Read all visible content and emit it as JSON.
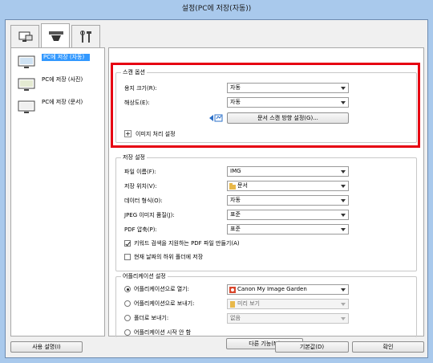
{
  "window": {
    "title": "설정(PC에 저장(자동))"
  },
  "tabs": [
    {
      "icon": "scan-to-pc-icon"
    },
    {
      "icon": "scanner-icon"
    },
    {
      "icon": "tools-icon"
    }
  ],
  "sidebar": {
    "items": [
      {
        "label": "PC에 저장 (자동)",
        "active": true
      },
      {
        "label": "PC에 저장 (사진)",
        "active": false
      },
      {
        "label": "PC에 저장 (문서)",
        "active": false
      }
    ]
  },
  "scan_options": {
    "title": "스캔 옵션",
    "paper_size_label": "용지 크기(R):",
    "paper_size_value": "자동",
    "resolution_label": "해상도(E):",
    "resolution_value": "자동",
    "doc_orientation_button": "문서 스캔 방향 설정(G)...",
    "image_processing_label": "이미지 처리 설정"
  },
  "save_settings": {
    "title": "저장 설정",
    "file_name_label": "파일 이름(F):",
    "file_name_value": "IMG",
    "save_in_label": "저장 위치(V):",
    "save_in_value": "문서",
    "data_format_label": "데이터 형식(O):",
    "data_format_value": "자동",
    "jpeg_quality_label": "JPEG 이미지 품질(J):",
    "jpeg_quality_value": "표준",
    "pdf_compression_label": "PDF 압축(P):",
    "pdf_compression_value": "표준",
    "keyword_pdf_label": "키워드 검색을 지원하는 PDF 파일 만들기(A)",
    "keyword_pdf_checked": true,
    "subfolder_label": "현재 날짜의 하위 폴더에 저장",
    "subfolder_checked": false
  },
  "app_settings": {
    "title": "어플리케이션 설정",
    "open_with_label": "어플리케이션으로 열기:",
    "open_with_value": "Canon My Image Garden",
    "send_to_app_label": "어플리케이션으로 보내기:",
    "send_to_app_value": "미리 보기",
    "send_to_folder_label": "폴더로 보내기:",
    "send_to_folder_value": "없음",
    "do_not_start_label": "어플리케이션 시작 안 함",
    "more_functions_button": "다른 기능(M)"
  },
  "footer": {
    "instructions_button": "사용 설명(I)",
    "defaults_button": "기본값(D)",
    "ok_button": "확인"
  },
  "colors": {
    "highlight": "#e60012",
    "selection": "#3399ff"
  }
}
